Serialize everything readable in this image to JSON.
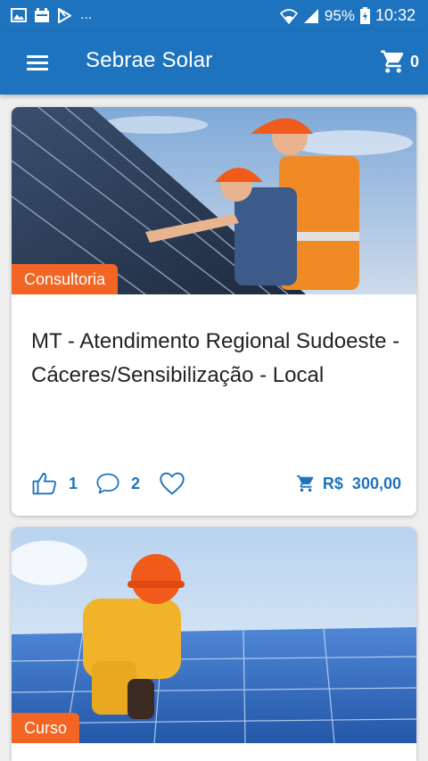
{
  "status_bar": {
    "battery": "95%",
    "time": "10:32",
    "overflow": "..."
  },
  "app_bar": {
    "title": "Sebrae Solar",
    "cart_count": "0"
  },
  "cards": [
    {
      "category": "Consultoria",
      "title": "MT - Atendimento Regional Sudoeste - Cáceres/Sensibilização - Local",
      "likes": "1",
      "comments": "2",
      "price": "R$  300,00"
    },
    {
      "category": "Curso"
    }
  ],
  "colors": {
    "primary": "#1e73be",
    "badge": "#f26522",
    "background": "#eeeeee"
  }
}
